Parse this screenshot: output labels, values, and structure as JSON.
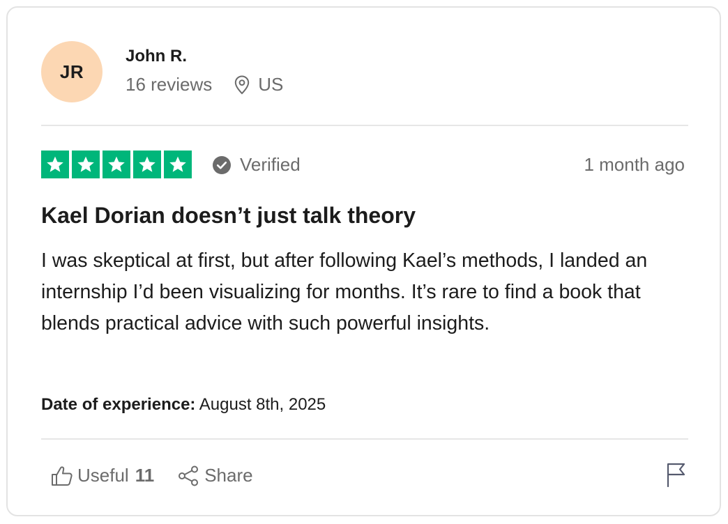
{
  "reviewer": {
    "initials": "JR",
    "name": "John R.",
    "reviews_count": "16 reviews",
    "location": "US",
    "avatar_color": "#fcd7b3"
  },
  "rating": {
    "stars": 5,
    "max_stars": 5,
    "star_color": "#00b67a",
    "verified_label": "Verified",
    "posted": "1 month ago"
  },
  "review": {
    "title": "Kael Dorian doesn’t just talk theory",
    "body": "I was skeptical at first, but after following Kael’s methods, I landed an internship I’d been visualizing for months. It’s rare to find a book that blends practical advice with such powerful insights.",
    "experience_label": "Date of experience:",
    "experience_date": "August 8th, 2025"
  },
  "actions": {
    "useful_label": "Useful",
    "useful_count": "11",
    "share_label": "Share",
    "icons": [
      "thumbs-up-icon",
      "share-icon",
      "flag-icon"
    ]
  }
}
